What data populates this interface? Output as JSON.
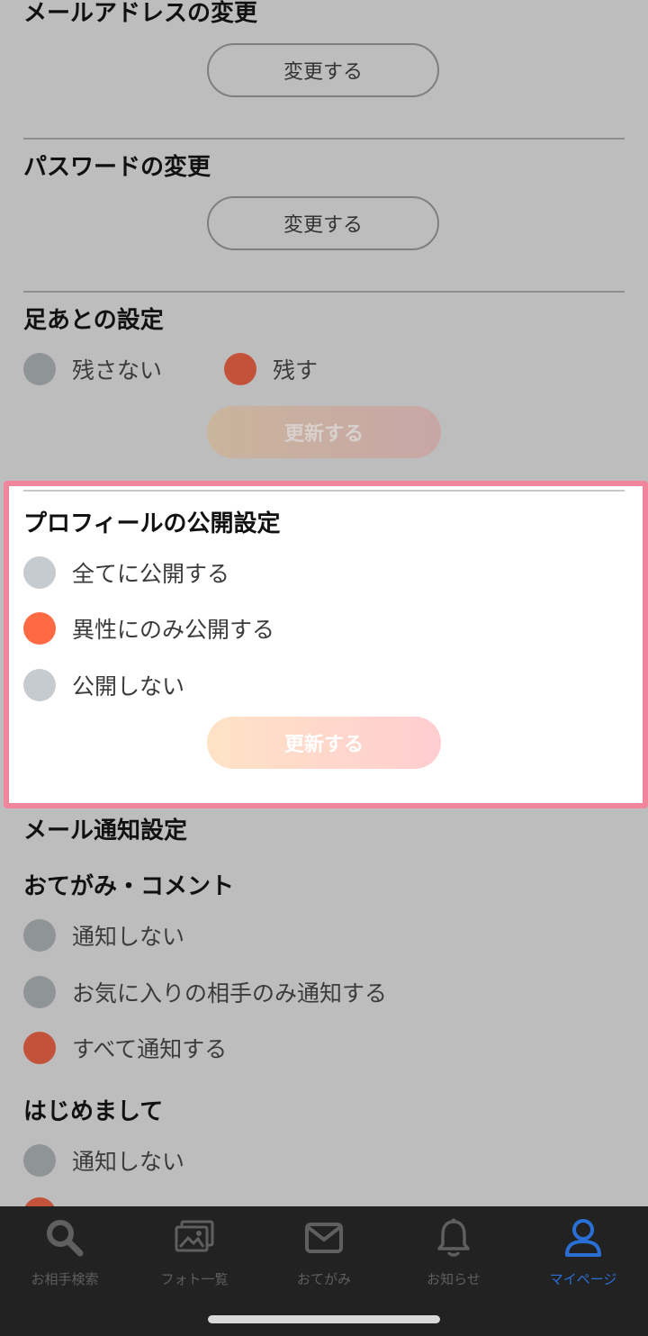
{
  "email_change": {
    "title": "メールアドレスの変更",
    "button": "変更する"
  },
  "password_change": {
    "title": "パスワードの変更",
    "button": "変更する"
  },
  "footprint": {
    "title": "足あとの設定",
    "options": [
      "残さない",
      "残す"
    ],
    "selected": "残す",
    "update_button": "更新する"
  },
  "profile_visibility": {
    "title": "プロフィールの公開設定",
    "options": [
      "全てに公開する",
      "異性にのみ公開する",
      "公開しない"
    ],
    "selected": "異性にのみ公開する",
    "update_button": "更新する"
  },
  "mail_notification": {
    "title": "メール通知設定",
    "otegami_comment": {
      "title": "おてがみ・コメント",
      "options": [
        "通知しない",
        "お気に入りの相手のみ通知する",
        "すべて通知する"
      ],
      "selected": "すべて通知する"
    },
    "hajimemashite": {
      "title": "はじめまして",
      "options": [
        "通知しない"
      ]
    }
  },
  "tabbar": {
    "items": [
      {
        "label": "お相手検索",
        "icon": "search-icon"
      },
      {
        "label": "フォト一覧",
        "icon": "photos-icon"
      },
      {
        "label": "おてがみ",
        "icon": "mail-icon"
      },
      {
        "label": "お知らせ",
        "icon": "bell-icon"
      },
      {
        "label": "マイページ",
        "icon": "user-icon"
      }
    ],
    "active": "マイページ"
  },
  "colors": {
    "overlay_bg": "#bdbdbd",
    "highlight_border": "#f0859c",
    "radio_selected": "#ff6a45",
    "tab_active": "#2a6fd6"
  }
}
